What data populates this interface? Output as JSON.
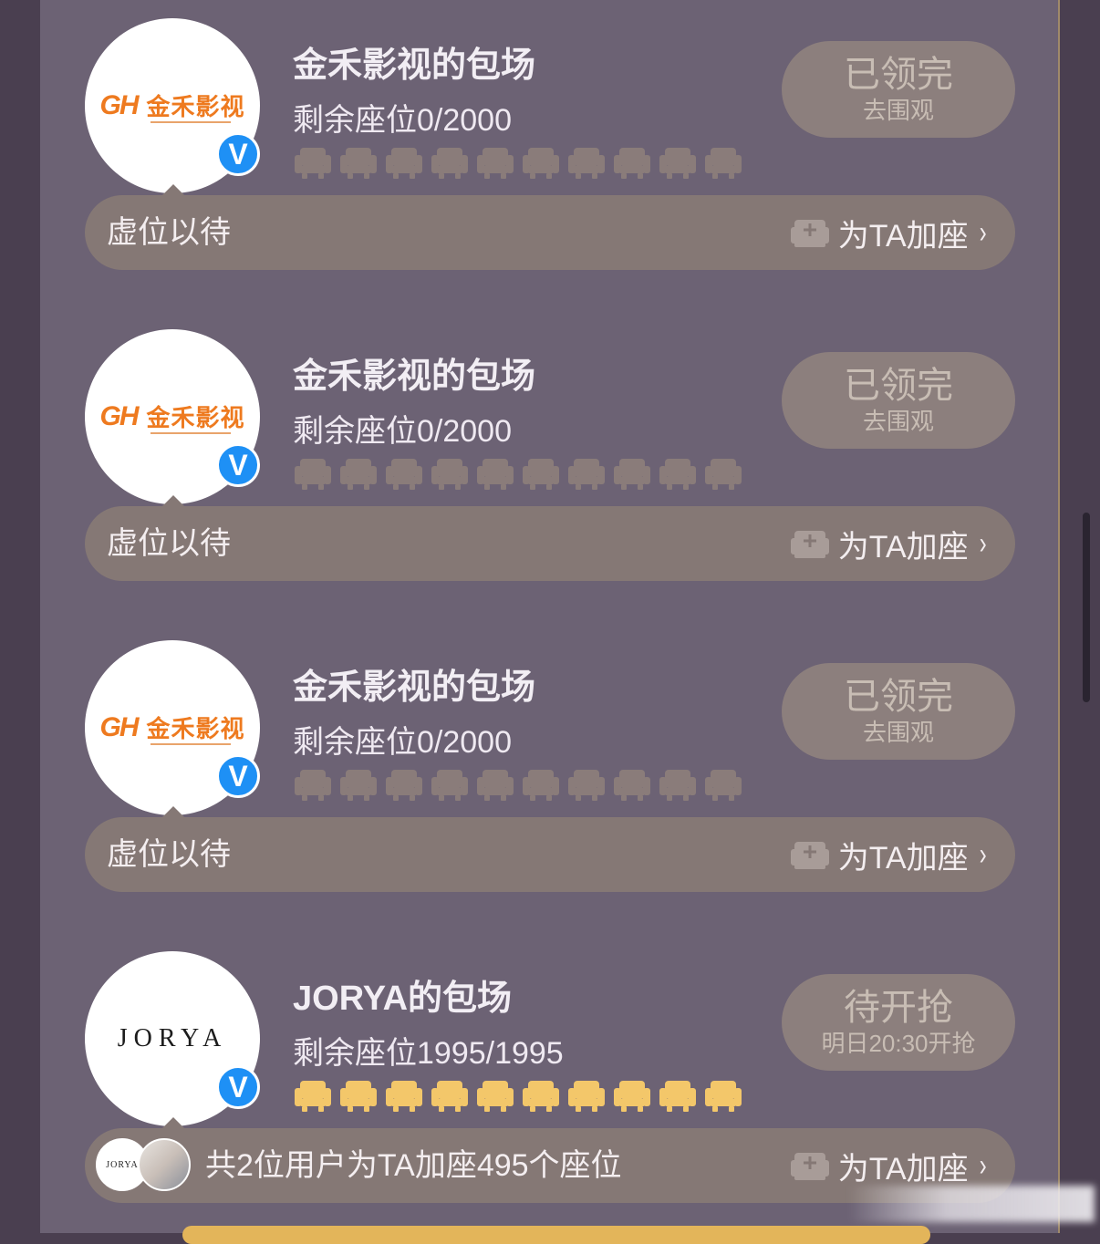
{
  "colors": {
    "background": "#4a3f50",
    "panel": "#6c6274",
    "bar": "#857875",
    "status_button": "#8c7f7d",
    "seat_empty": "#8a7c7a",
    "seat_available": "#f3c76a",
    "verified_badge": "#1e90f5",
    "logo_orange": "#ee7a1f"
  },
  "cards": [
    {
      "avatar": {
        "mark": "GH",
        "name": "金禾影视"
      },
      "title": "金禾影视的包场",
      "seats_text": "剩余座位0/2000",
      "seat_state": "empty",
      "status_main": "已领完",
      "status_sub": "去围观",
      "bar_text": "虚位以待",
      "add_label": "为TA加座",
      "add_icon": "seat-plus-icon"
    },
    {
      "avatar": {
        "mark": "GH",
        "name": "金禾影视"
      },
      "title": "金禾影视的包场",
      "seats_text": "剩余座位0/2000",
      "seat_state": "empty",
      "status_main": "已领完",
      "status_sub": "去围观",
      "bar_text": "虚位以待",
      "add_label": "为TA加座",
      "add_icon": "seat-plus-icon"
    },
    {
      "avatar": {
        "mark": "GH",
        "name": "金禾影视"
      },
      "title": "金禾影视的包场",
      "seats_text": "剩余座位0/2000",
      "seat_state": "empty",
      "status_main": "已领完",
      "status_sub": "去围观",
      "bar_text": "虚位以待",
      "add_label": "为TA加座",
      "add_icon": "seat-plus-icon"
    },
    {
      "avatar": {
        "name": "JORYA"
      },
      "title": "JORYA的包场",
      "seats_text": "剩余座位1995/1995",
      "seat_state": "available",
      "status_main": "待开抢",
      "status_sub": "明日20:30开抢",
      "bar_text": "共2位用户为TA加座495个座位",
      "mini_avatar_1": "JORYA",
      "add_label": "为TA加座",
      "add_icon": "seat-plus-icon"
    }
  ],
  "icons": {
    "verified": "V",
    "chevron": "›"
  }
}
